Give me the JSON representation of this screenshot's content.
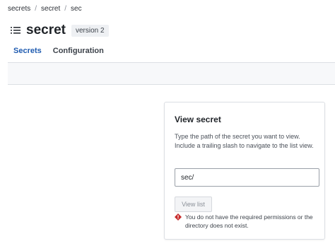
{
  "breadcrumb": {
    "items": [
      {
        "label": "secrets"
      },
      {
        "label": "secret"
      },
      {
        "label": "sec"
      }
    ],
    "separator": "/"
  },
  "header": {
    "icon": "list-icon",
    "title": "secret",
    "version_badge": "version 2"
  },
  "tabs": [
    {
      "label": "Secrets",
      "active": true
    },
    {
      "label": "Configuration",
      "active": false
    }
  ],
  "view_secret": {
    "title": "View secret",
    "help_text": "Type the path of the secret you want to view. Include a trailing slash to navigate to the list view.",
    "path_value": "sec/",
    "button_label": "View list",
    "error_icon": "warning-diamond-icon",
    "error_text": "You do not have the required permissions or the directory does not exist."
  },
  "colors": {
    "accent": "#1f5bb0",
    "error": "#c62828",
    "border": "#dcdfe4"
  }
}
